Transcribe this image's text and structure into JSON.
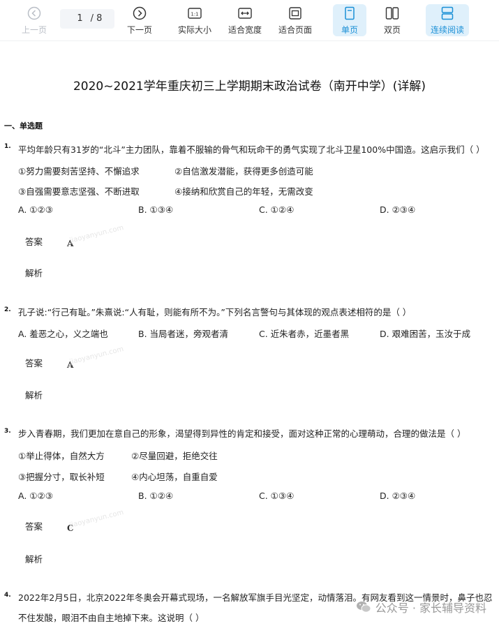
{
  "toolbar": {
    "prev_label": "上一页",
    "page_current": "1",
    "page_total_text": "/ 8",
    "next_label": "下一页",
    "actual_size_label": "实际大小",
    "fit_width_label": "适合宽度",
    "fit_page_label": "适合页面",
    "single_page_label": "单页",
    "double_page_label": "双页",
    "continuous_label": "连续阅读",
    "actual_size_icon_text": "1:1"
  },
  "document": {
    "title": "2020~2021学年重庆初三上学期期末政治试卷（南开中学）(详解)",
    "section": "一、单选题",
    "answer_label": "答案",
    "explanation_label": "解析",
    "watermark": "jiaoyanyun.com",
    "questions": [
      {
        "num": "1.",
        "stem": "平均年龄只有31岁的“北斗”主力团队，靠着不服输的骨气和玩命干的勇气实现了北斗卫星100%中国造。这启示我们（    ）",
        "statements": [
          "①努力需要刻苦坚持、不懈追求",
          "②自信激发潜能，获得更多创造可能",
          "③自强需要意志坚强、不断进取",
          "④接纳和欣赏自己的年轻，无需改变"
        ],
        "options": [
          "A. ①②③",
          "B. ①③④",
          "C. ①②④",
          "D. ②③④"
        ],
        "answer": "A"
      },
      {
        "num": "2.",
        "stem": "孔子说:“行己有耻。”朱熹说:“人有耻，则能有所不为。”下列名言警句与其体现的观点表述相符的是（    ）",
        "options": [
          "A. 羞恶之心，义之端也",
          "B. 当局者迷，旁观者清",
          "C. 近朱者赤，近墨者黑",
          "D. 艰难困苦，玉汝于成"
        ],
        "answer": "A"
      },
      {
        "num": "3.",
        "stem": "步入青春期，我们更加在意自己的形象，渴望得到异性的肯定和接受，面对这种正常的心理萌动，合理的做法是（    ）",
        "statements": [
          "①举止得体，自然大方",
          "②尽量回避，拒绝交往",
          "③把握分寸，取长补短",
          "④内心坦荡，自重自爱"
        ],
        "options": [
          "A. ①②③",
          "B. ①②④",
          "C. ①③④",
          "D. ②③④"
        ],
        "answer": "C"
      },
      {
        "num": "4.",
        "stem": "2022年2月5日，北京2022年冬奥会开幕式现场，一名解放军旗手目光坚定，动情落泪。有网友看到这一情景时，鼻子也忍不住发酸，眼泪不由自主地掉下来。这说明（    ）"
      }
    ]
  },
  "footer_watermark": "公众号 · 家长辅导资料"
}
